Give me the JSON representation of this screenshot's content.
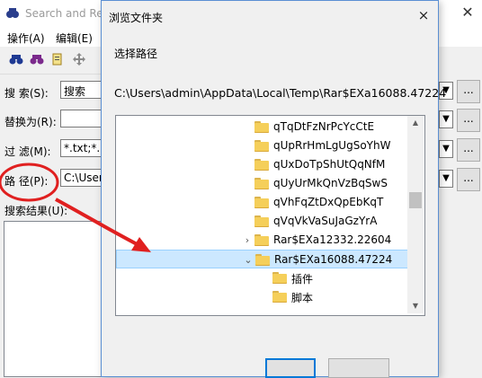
{
  "background_window": {
    "title": "Search and Re",
    "menu": [
      "操作(A)",
      "编辑(E)"
    ],
    "toolbar_icons": [
      "binoculars-icon",
      "binoculars-pair-icon",
      "replace-icon",
      "move-icon"
    ],
    "fields": {
      "search": {
        "label": "搜    索(S):",
        "value": "搜索"
      },
      "replace": {
        "label": "替换为(R):",
        "value": ""
      },
      "filter": {
        "label": "过    滤(M):",
        "value": "*.txt;*.hl"
      },
      "path": {
        "label": "路    径(P):",
        "value": "C:\\Users"
      }
    },
    "browse_label": "...",
    "results_label": "搜索结果(U):"
  },
  "dialog": {
    "title": "浏览文件夹",
    "close_label": "×",
    "prompt": "选择路径",
    "selected_path": "C:\\Users\\admin\\AppData\\Local\\Temp\\Rar$EXa16088.47224",
    "tree": [
      {
        "label": "qTqDtFzNrPcYcCtE",
        "level": 0,
        "expander": ""
      },
      {
        "label": "qUpRrHmLgUgSoYhW",
        "level": 0,
        "expander": ""
      },
      {
        "label": "qUxDoTpShUtQqNfM",
        "level": 0,
        "expander": ""
      },
      {
        "label": "qUyUrMkQnVzBqSwS",
        "level": 0,
        "expander": ""
      },
      {
        "label": "qVhFqZtDxQpEbKqT",
        "level": 0,
        "expander": ""
      },
      {
        "label": "qVqVkVaSuJaGzYrA",
        "level": 0,
        "expander": ""
      },
      {
        "label": "Rar$EXa12332.22604",
        "level": 0,
        "expander": "›"
      },
      {
        "label": "Rar$EXa16088.47224",
        "level": 0,
        "expander": "⌄",
        "selected": true
      },
      {
        "label": "插件",
        "level": 1,
        "expander": ""
      },
      {
        "label": "脚本",
        "level": 1,
        "expander": ""
      }
    ],
    "ok_label": "",
    "cancel_label": ""
  },
  "colors": {
    "selection": "#cce8ff",
    "folder": "#f5cf5a",
    "annotation": "#e02020",
    "accent": "#0078d7"
  }
}
